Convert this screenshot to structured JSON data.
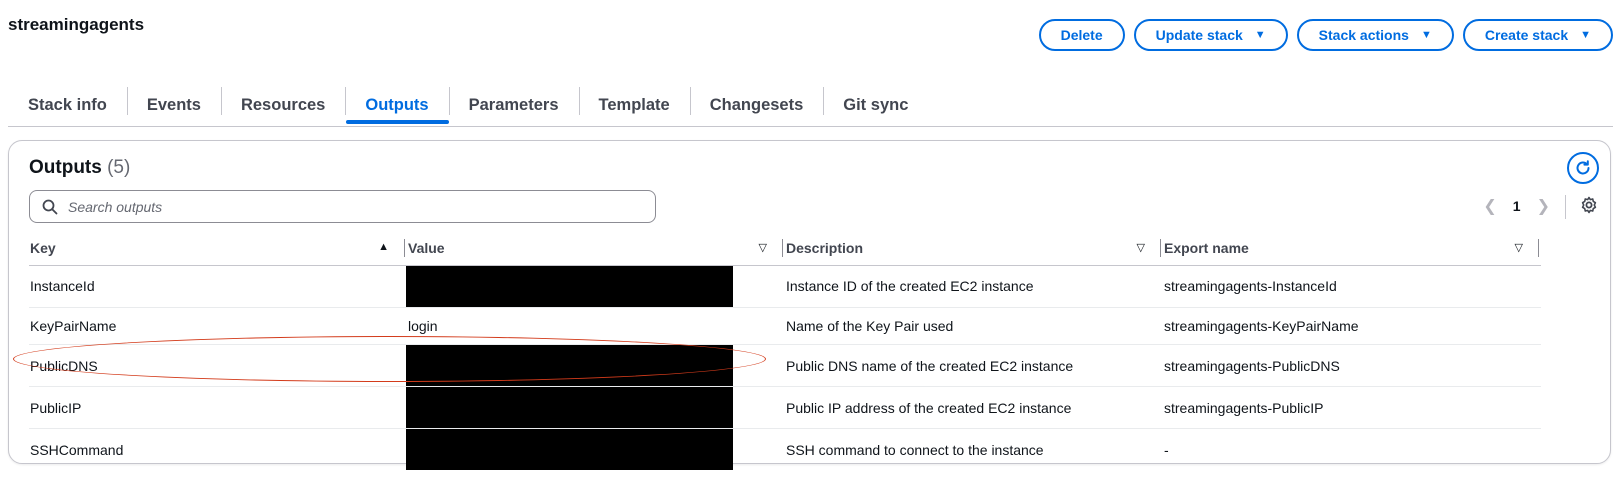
{
  "stack": {
    "title": "streamingagents"
  },
  "actions": {
    "delete": "Delete",
    "update": "Update stack",
    "stack_actions": "Stack actions",
    "create": "Create stack"
  },
  "tabs": [
    {
      "label": "Stack info"
    },
    {
      "label": "Events"
    },
    {
      "label": "Resources"
    },
    {
      "label": "Outputs",
      "active": true
    },
    {
      "label": "Parameters"
    },
    {
      "label": "Template"
    },
    {
      "label": "Changesets"
    },
    {
      "label": "Git sync"
    }
  ],
  "outputs": {
    "title": "Outputs",
    "count": "(5)",
    "search_placeholder": "Search outputs",
    "page": "1",
    "columns": [
      "Key",
      "Value",
      "Description",
      "Export name"
    ],
    "rows": [
      {
        "key": "InstanceId",
        "value": "",
        "value_redacted": true,
        "description": "Instance ID of the created EC2 instance",
        "export": "streamingagents-InstanceId"
      },
      {
        "key": "KeyPairName",
        "value": "login",
        "value_redacted": false,
        "description": "Name of the Key Pair used",
        "export": "streamingagents-KeyPairName"
      },
      {
        "key": "PublicDNS",
        "value": "",
        "value_redacted": true,
        "description": "Public DNS name of the created EC2 instance",
        "export": "streamingagents-PublicDNS"
      },
      {
        "key": "PublicIP",
        "value": "",
        "value_redacted": true,
        "description": "Public IP address of the created EC2 instance",
        "export": "streamingagents-PublicIP"
      },
      {
        "key": "SSHCommand",
        "value": "",
        "value_redacted": true,
        "description": "SSH command to connect to the instance",
        "export": "-"
      }
    ]
  },
  "colors": {
    "accent": "#006ce0",
    "annotation": "#d33b1b",
    "redaction": "#000000"
  },
  "icons": {
    "search": "search-icon",
    "refresh": "refresh-icon",
    "settings": "gear-icon",
    "sort_asc": "sort-ascending-icon",
    "sort": "sort-icon"
  }
}
